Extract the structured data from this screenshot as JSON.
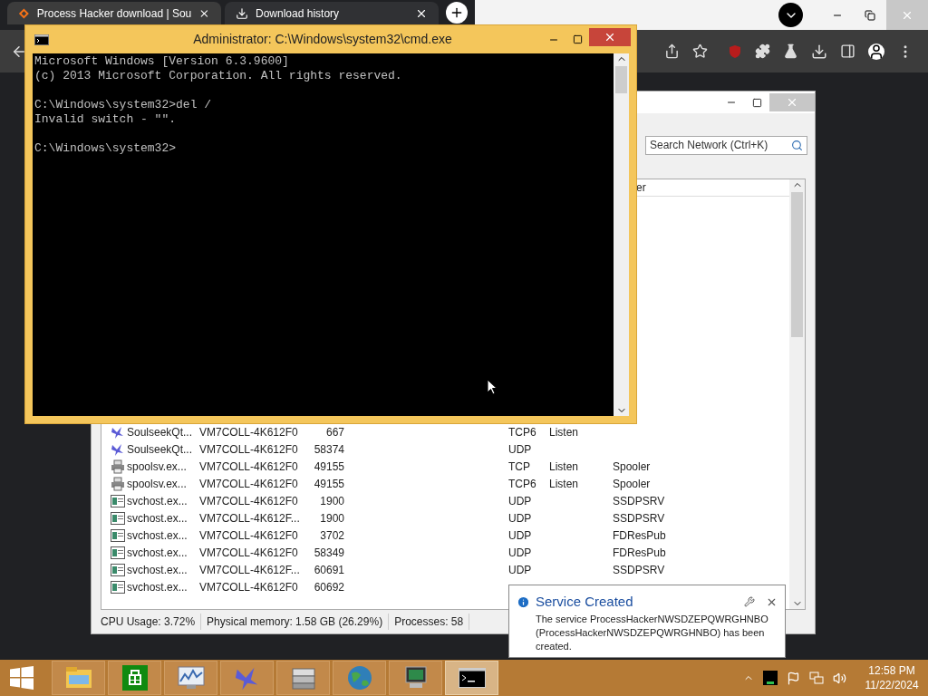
{
  "browser": {
    "tabs": [
      {
        "label": "Process Hacker download | Sou",
        "kind": "site",
        "selected": true
      },
      {
        "label": "Download history",
        "kind": "downloads",
        "selected": false
      }
    ]
  },
  "cmd_window": {
    "title": "Administrator: C:\\Windows\\system32\\cmd.exe",
    "output": "Microsoft Windows [Version 6.3.9600]\n(c) 2013 Microsoft Corporation. All rights reserved.\n\nC:\\Windows\\system32>del /\nInvalid switch - \"\".\n\nC:\\Windows\\system32>"
  },
  "network_window": {
    "search": {
      "placeholder": "Search Network (Ctrl+K)"
    },
    "column_header": "er",
    "rows": [
      {
        "kind": "bird",
        "name": "SoulseekQt...",
        "local_address": "VM7COLL-4K612F0",
        "local_port": "667",
        "protocol": "TCP6",
        "state": "Listen"
      },
      {
        "kind": "bird",
        "name": "SoulseekQt...",
        "local_address": "VM7COLL-4K612F0",
        "local_port": "58374",
        "protocol": "UDP"
      },
      {
        "kind": "printer",
        "name": "spoolsv.ex...",
        "local_address": "VM7COLL-4K612F0",
        "local_port": "49155",
        "protocol": "TCP",
        "state": "Listen",
        "service": "Spooler"
      },
      {
        "kind": "printer",
        "name": "spoolsv.ex...",
        "local_address": "VM7COLL-4K612F0",
        "local_port": "49155",
        "protocol": "TCP6",
        "state": "Listen",
        "service": "Spooler"
      },
      {
        "kind": "service",
        "name": "svchost.ex...",
        "local_address": "VM7COLL-4K612F0",
        "local_port": "1900",
        "protocol": "UDP",
        "service": "SSDPSRV"
      },
      {
        "kind": "service",
        "name": "svchost.ex...",
        "local_address": "VM7COLL-4K612F...",
        "local_port": "1900",
        "protocol": "UDP",
        "service": "SSDPSRV"
      },
      {
        "kind": "service",
        "name": "svchost.ex...",
        "local_address": "VM7COLL-4K612F0",
        "local_port": "3702",
        "protocol": "UDP",
        "service": "FDResPub"
      },
      {
        "kind": "service",
        "name": "svchost.ex...",
        "local_address": "VM7COLL-4K612F0",
        "local_port": "58349",
        "protocol": "UDP",
        "service": "FDResPub"
      },
      {
        "kind": "service",
        "name": "svchost.ex...",
        "local_address": "VM7COLL-4K612F...",
        "local_port": "60691",
        "protocol": "UDP",
        "service": "SSDPSRV"
      },
      {
        "kind": "service",
        "name": "svchost.ex...",
        "local_address": "VM7COLL-4K612F0",
        "local_port": "60692"
      }
    ],
    "status_bar": [
      "CPU Usage: 3.72%",
      "Physical memory: 1.58 GB (26.29%)",
      "Processes: 58"
    ]
  },
  "notification": {
    "title": "Service Created",
    "message": "The service ProcessHackerNWSDZEPQWRGHNBO (ProcessHackerNWSDZEPQWRGHNBO) has been created."
  },
  "taskbar": {
    "items": [
      {
        "kind": "folder",
        "selected": false
      },
      {
        "kind": "store",
        "selected": false
      },
      {
        "kind": "monitor",
        "selected": false
      },
      {
        "kind": "bird",
        "selected": false
      },
      {
        "kind": "server",
        "selected": false
      },
      {
        "kind": "globe",
        "selected": false
      },
      {
        "kind": "computer",
        "selected": false
      },
      {
        "kind": "console",
        "selected": true
      }
    ],
    "time": "12:58 PM",
    "date": "11/22/2024"
  }
}
